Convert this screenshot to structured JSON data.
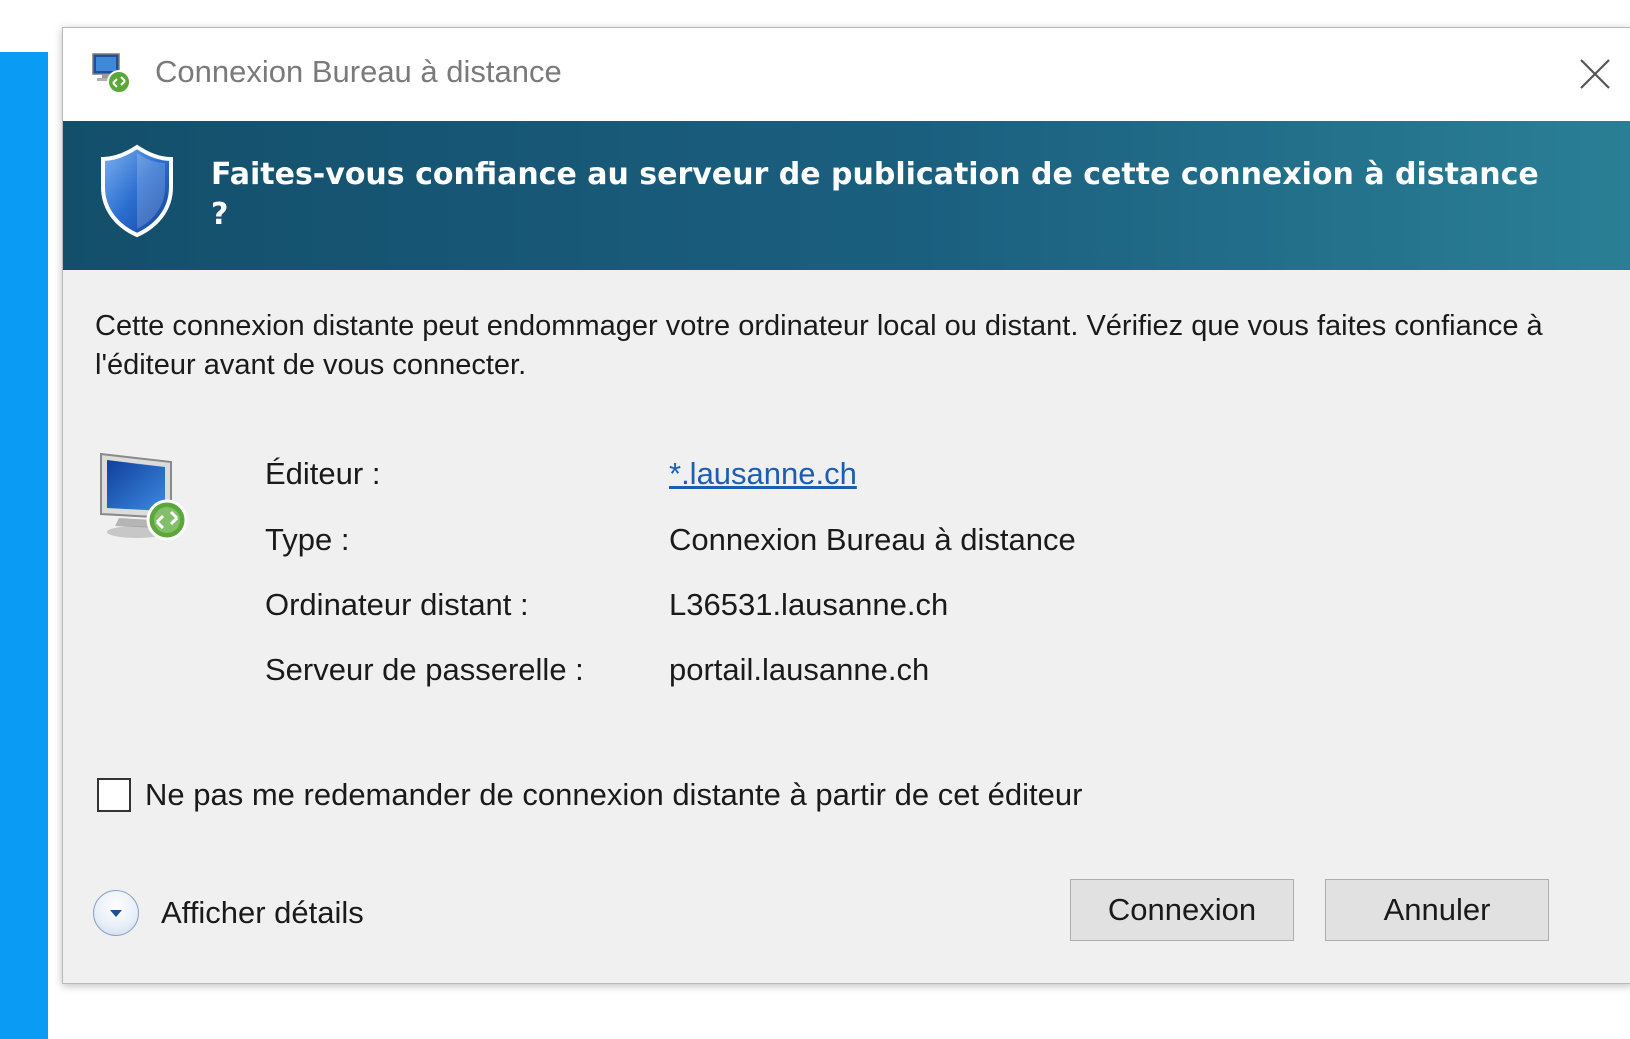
{
  "window": {
    "title": "Connexion Bureau à distance",
    "app_icon": "remote-desktop-icon",
    "close_icon": "close-icon"
  },
  "banner": {
    "title": "Faites-vous confiance au serveur de publication de cette connexion à distance ?",
    "icon": "shield-icon",
    "colors": {
      "start": "#134f6b",
      "end": "#2a7f95"
    }
  },
  "warning": "Cette connexion distante peut endommager votre ordinateur local ou distant. Vérifiez que vous faites confiance à l'éditeur avant de vous connecter.",
  "info": {
    "icon": "computer-connection-icon",
    "rows": [
      {
        "label": "Éditeur :",
        "value": "*.lausanne.ch"
      },
      {
        "label": "Type :",
        "value": "Connexion Bureau à distance"
      },
      {
        "label": "Ordinateur distant :",
        "value": "L36531.lausanne.ch"
      },
      {
        "label": "Serveur de passerelle :",
        "value": "portail.lausanne.ch"
      }
    ]
  },
  "checkbox": {
    "label": "Ne pas me redemander de connexion distante à partir de cet éditeur",
    "checked": false
  },
  "details_toggle": "Afficher détails",
  "buttons": {
    "connect": "Connexion",
    "cancel": "Annuler"
  },
  "colors": {
    "accent_strip": "#0a9cf5",
    "link": "#1a5fb4",
    "dialog_bg": "#f0f0f0"
  }
}
